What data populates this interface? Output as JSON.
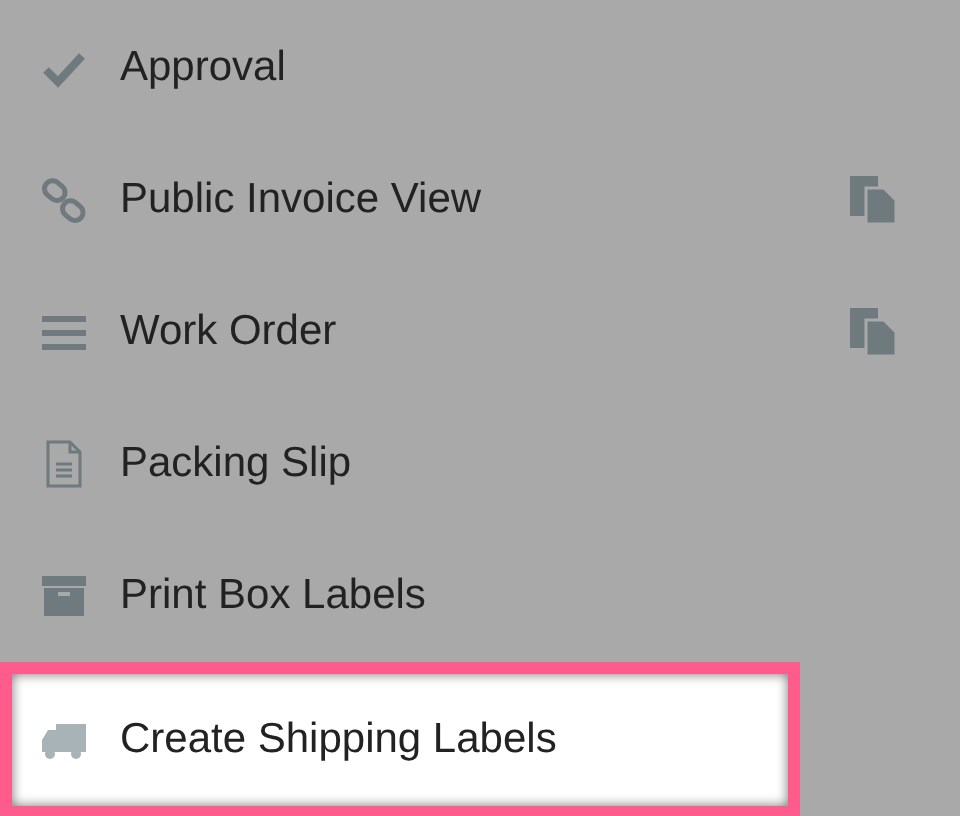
{
  "menu": {
    "items": [
      {
        "label": "Approval",
        "kind": "check",
        "copy": false,
        "selected": false
      },
      {
        "label": "Public Invoice View",
        "kind": "link",
        "copy": true,
        "selected": false
      },
      {
        "label": "Work Order",
        "kind": "list",
        "copy": true,
        "selected": false
      },
      {
        "label": "Packing Slip",
        "kind": "document",
        "copy": false,
        "selected": false
      },
      {
        "label": "Print Box Labels",
        "kind": "box",
        "copy": false,
        "selected": false
      },
      {
        "label": "Create Shipping Labels",
        "kind": "truck",
        "copy": false,
        "selected": true
      }
    ]
  }
}
